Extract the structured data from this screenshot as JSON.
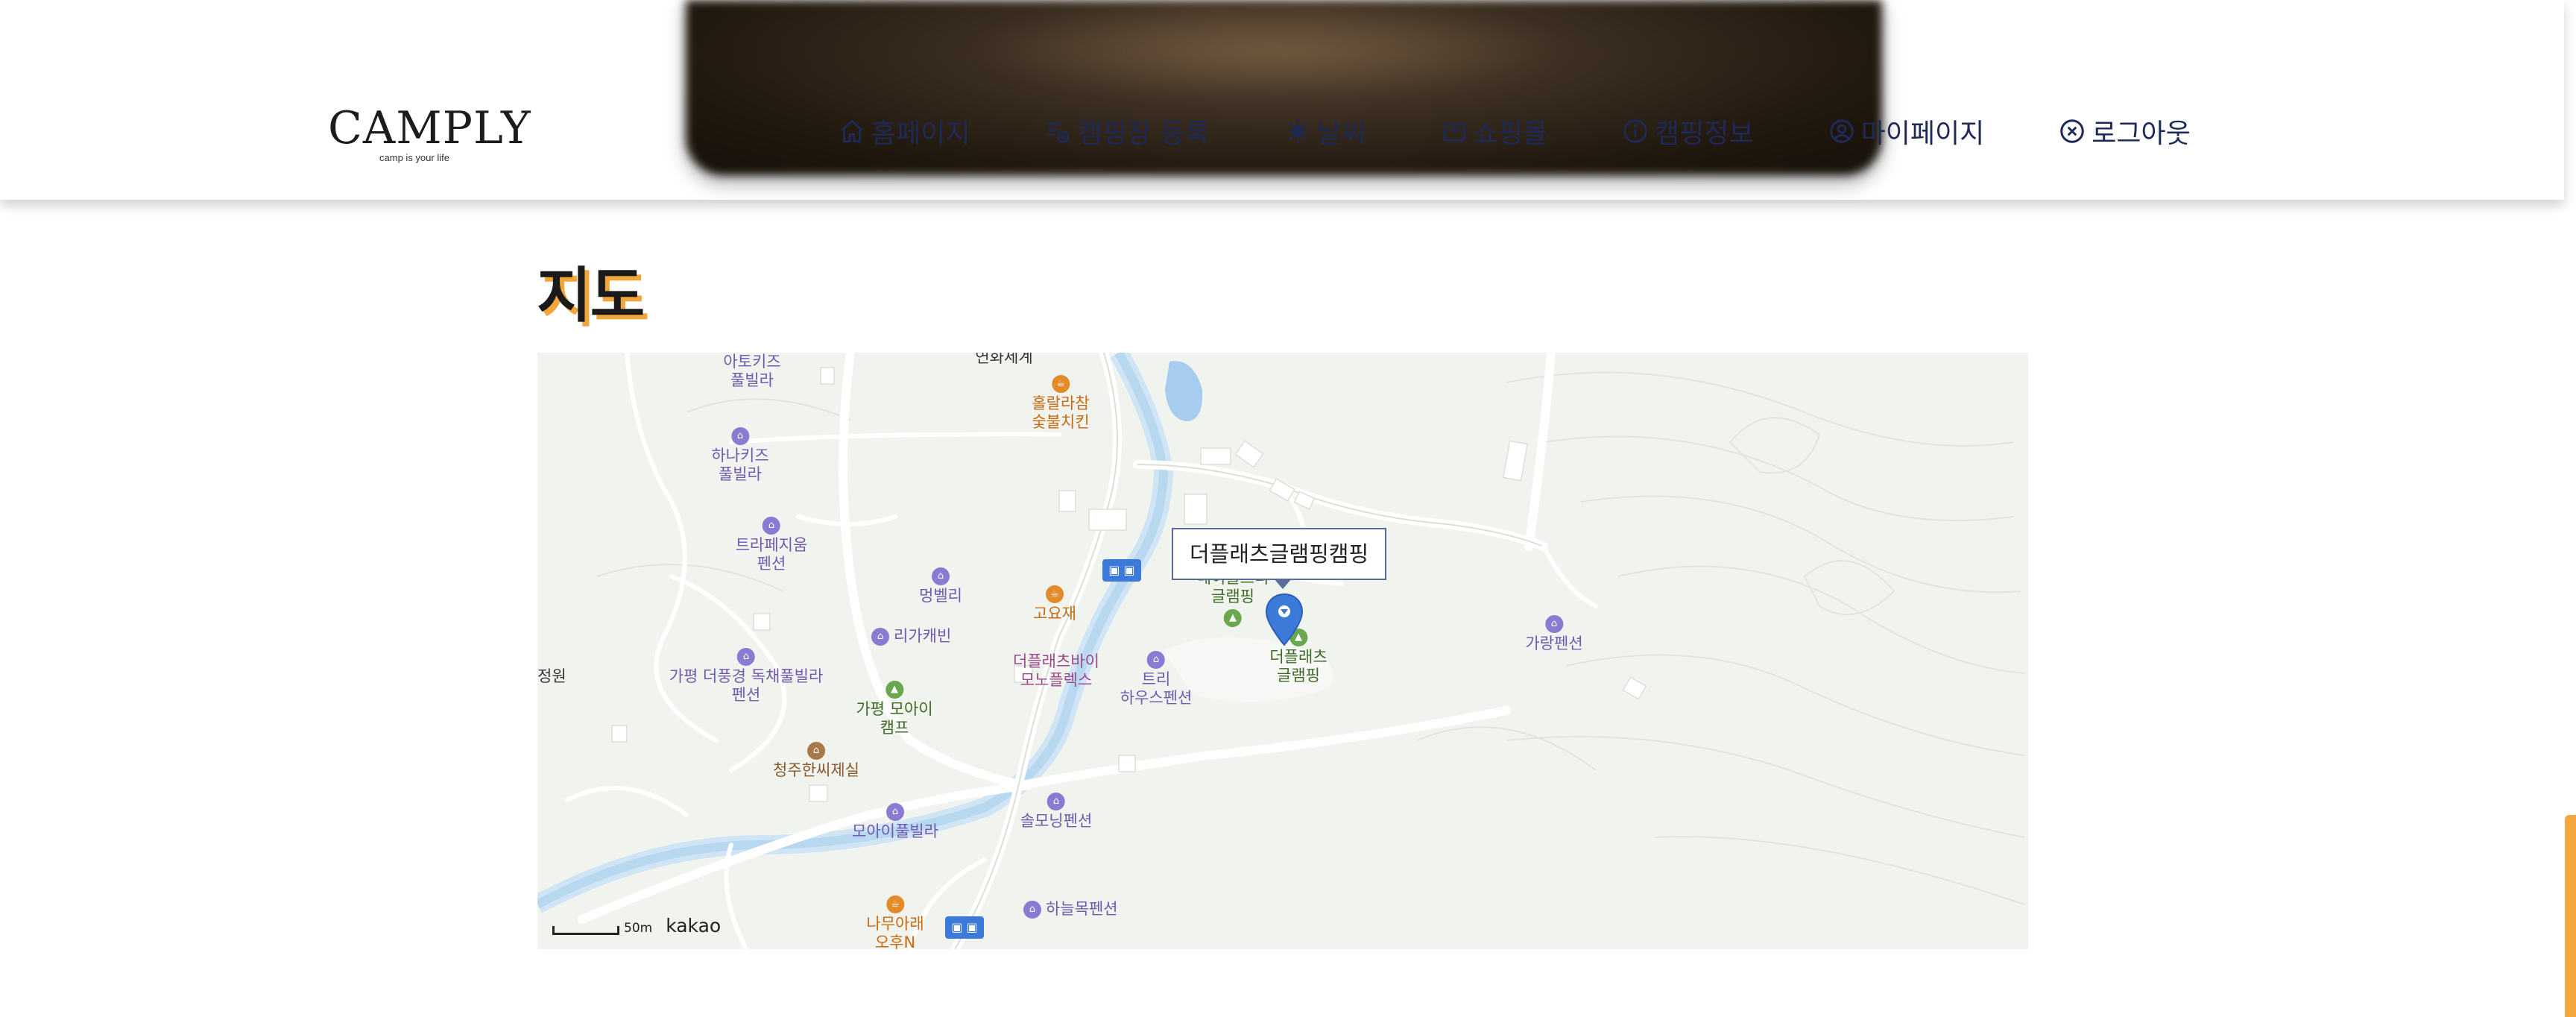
{
  "header": {
    "logo": {
      "title": "CAMPLY",
      "tagline": "camp is your life"
    },
    "nav": [
      {
        "label": "홈페이지",
        "icon": "home-icon"
      },
      {
        "label": "캠핑장 등록",
        "icon": "list-add-icon"
      },
      {
        "label": "날씨",
        "icon": "sun-icon"
      },
      {
        "label": "쇼핑몰",
        "icon": "shopping-bag-icon"
      },
      {
        "label": "캠핑정보",
        "icon": "info-icon"
      },
      {
        "label": "마이페이지",
        "icon": "user-circle-icon"
      },
      {
        "label": "로그아웃",
        "icon": "close-circle-icon"
      }
    ]
  },
  "main": {
    "title": "지도"
  },
  "map": {
    "infowindow": "더플래츠글램핑캠핑",
    "scale": "50m",
    "provider": "kakao",
    "pois": [
      {
        "label": "아토키즈",
        "label2": "풀빌라",
        "color": "purple"
      },
      {
        "label": "연화세계",
        "color": "plain"
      },
      {
        "label": "홀랄라참",
        "label2": "숯불치킨",
        "color": "orange"
      },
      {
        "label": "하나키즈",
        "label2": "풀빌라",
        "color": "purple"
      },
      {
        "label": "트라페지움",
        "label2": "펜션",
        "color": "purple"
      },
      {
        "label": "멍벨리",
        "color": "purple"
      },
      {
        "label": "고요재",
        "color": "orange"
      },
      {
        "label": "리가캐빈",
        "color": "purple"
      },
      {
        "label": "메이플트리",
        "label2": "글램핑",
        "color": "green"
      },
      {
        "label": "더플래츠",
        "label2": "글램핑",
        "color": "green"
      },
      {
        "label": "가랑펜션",
        "color": "purple"
      },
      {
        "label": "정원",
        "color": "plain"
      },
      {
        "label": "가평 더풍경 독채풀빌라",
        "label2": "펜션",
        "color": "purple"
      },
      {
        "label": "더플래츠바이",
        "label2": "모노플렉스",
        "color": "pink"
      },
      {
        "label": "트리",
        "label2": "하우스펜션",
        "color": "purple"
      },
      {
        "label": "가평 모아이",
        "label2": "캠프",
        "color": "green"
      },
      {
        "label": "청주한씨제실",
        "color": "brown"
      },
      {
        "label": "모아이풀빌라",
        "color": "purple"
      },
      {
        "label": "솔모닝펜션",
        "color": "purple"
      },
      {
        "label": "하늘목펜션",
        "color": "purple"
      },
      {
        "label": "나무아래",
        "label2": "오후N",
        "color": "orange"
      }
    ]
  },
  "colors": {
    "accent": "#f0a63a",
    "nav_text": "#1d2a55",
    "map_bg": "#f1f3ee",
    "marker": "#3b7ad9"
  }
}
